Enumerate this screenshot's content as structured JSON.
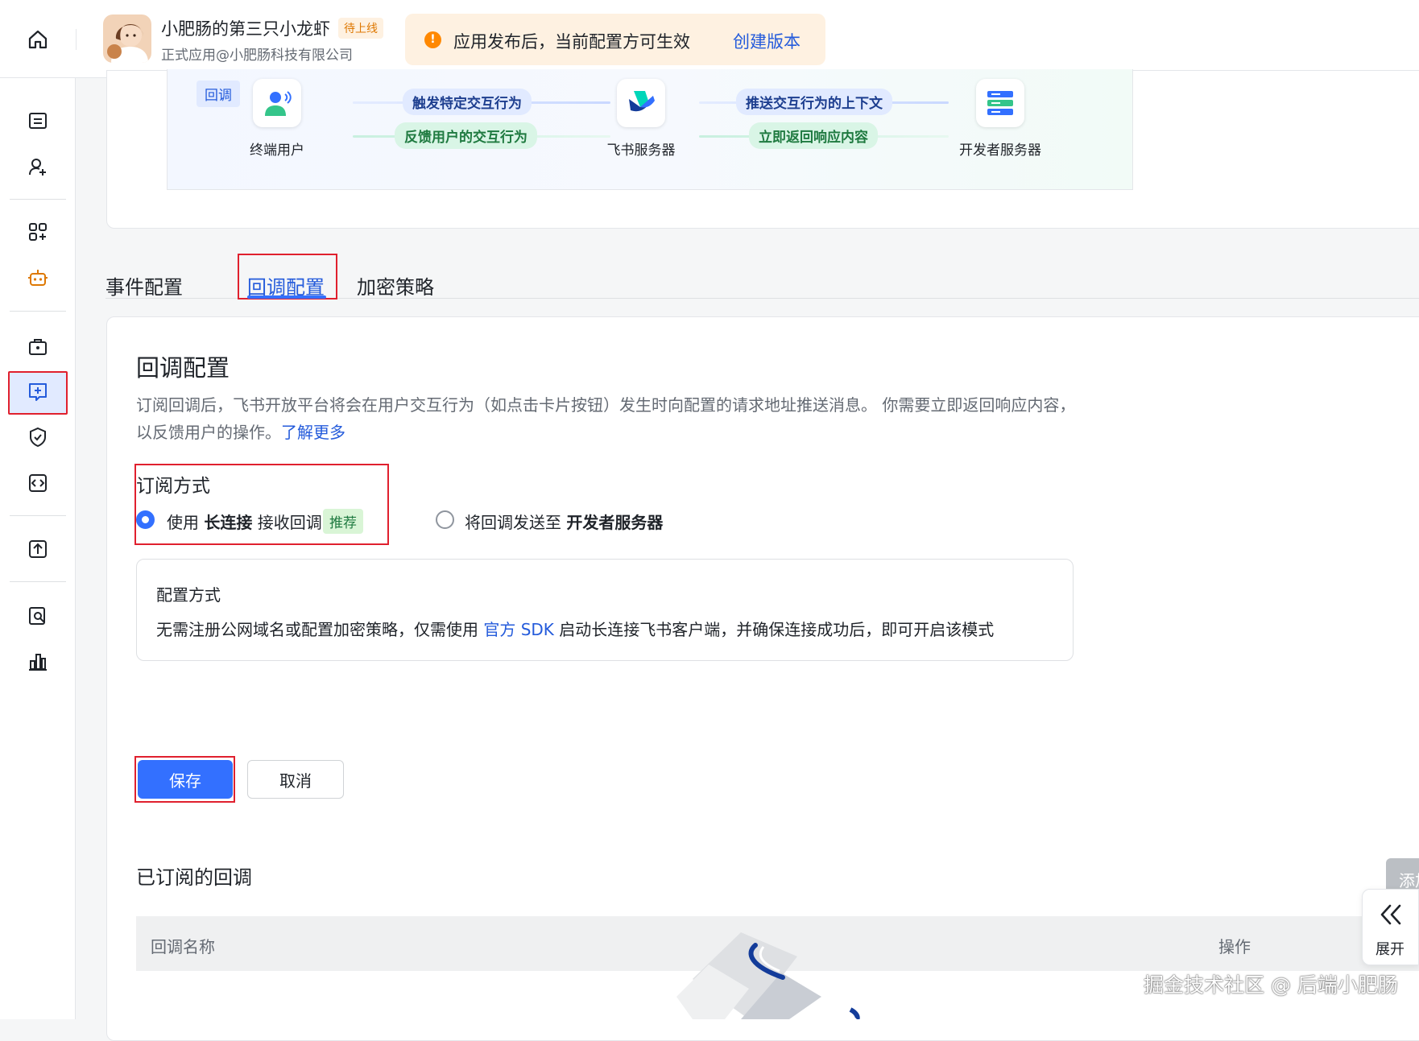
{
  "header": {
    "app_name": "小肥肠的第三只小龙虾",
    "status_badge": "待上线",
    "app_subtitle": "正式应用@小肥肠科技有限公司",
    "notice_text": "应用发布后，当前配置方可生效",
    "notice_link": "创建版本"
  },
  "flow": {
    "tag": "回调",
    "nodes": [
      "终端用户",
      "飞书服务器",
      "开发者服务器"
    ],
    "arrows": {
      "top_left": "触发特定交互行为",
      "bottom_left": "反馈用户的交互行为",
      "top_right": "推送交互行为的上下文",
      "bottom_right": "立即返回响应内容"
    }
  },
  "tabs": [
    "事件配置",
    "回调配置",
    "加密策略"
  ],
  "active_tab": "回调配置",
  "section": {
    "title": "回调配置",
    "desc": "订阅回调后，飞书开放平台将会在用户交互行为（如点击卡片按钮）发生时向配置的请求地址推送消息。 你需要立即返回响应内容，以反馈用户的操作。",
    "learn_more": "了解更多"
  },
  "subscription": {
    "label": "订阅方式",
    "option1_pre": "使用 ",
    "option1_bold": "长连接",
    "option1_post": " 接收回调",
    "option1_tag": "推荐",
    "option1_selected": true,
    "option2_pre": "将回调发送至 ",
    "option2_bold": "开发者服务器",
    "option2_selected": false
  },
  "mode": {
    "title": "配置方式",
    "text_pre": "无需注册公网域名或配置加密策略，仅需使用 ",
    "text_link": "官方 SDK",
    "text_post": " 启动长连接飞书客户端，并确保连接成功后，即可开启该模式"
  },
  "buttons": {
    "save": "保存",
    "cancel": "取消",
    "add": "添加"
  },
  "subscribed": {
    "title": "已订阅的回调",
    "columns": [
      "回调名称",
      "操作"
    ]
  },
  "expand": {
    "label": "展开",
    "icon": "double-chevron-left-icon"
  },
  "watermark": "掘金技术社区 @ 后端小肥肠",
  "colors": {
    "primary": "#3370ff",
    "link": "#245bdb",
    "highlight_box": "#e0202e",
    "warning": "#ff8800"
  }
}
